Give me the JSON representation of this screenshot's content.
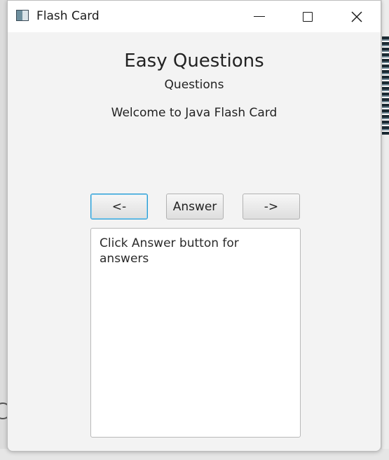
{
  "window": {
    "title": "Flash Card"
  },
  "content": {
    "title": "Easy Questions",
    "subtitle": "Questions",
    "welcome": "Welcome to Java Flash Card"
  },
  "buttons": {
    "prev_label": "<-",
    "answer_label": "Answer",
    "next_label": "->"
  },
  "answer_box": {
    "text": "Click Answer button for answers"
  },
  "icons": {
    "app": "flash-card-app-icon",
    "minimize": "minimize-icon",
    "maximize": "maximize-icon",
    "close": "close-icon"
  },
  "colors": {
    "focus_border": "#2a9bd2",
    "window_bg": "#f3f3f3",
    "titlebar_bg": "#ffffff"
  }
}
